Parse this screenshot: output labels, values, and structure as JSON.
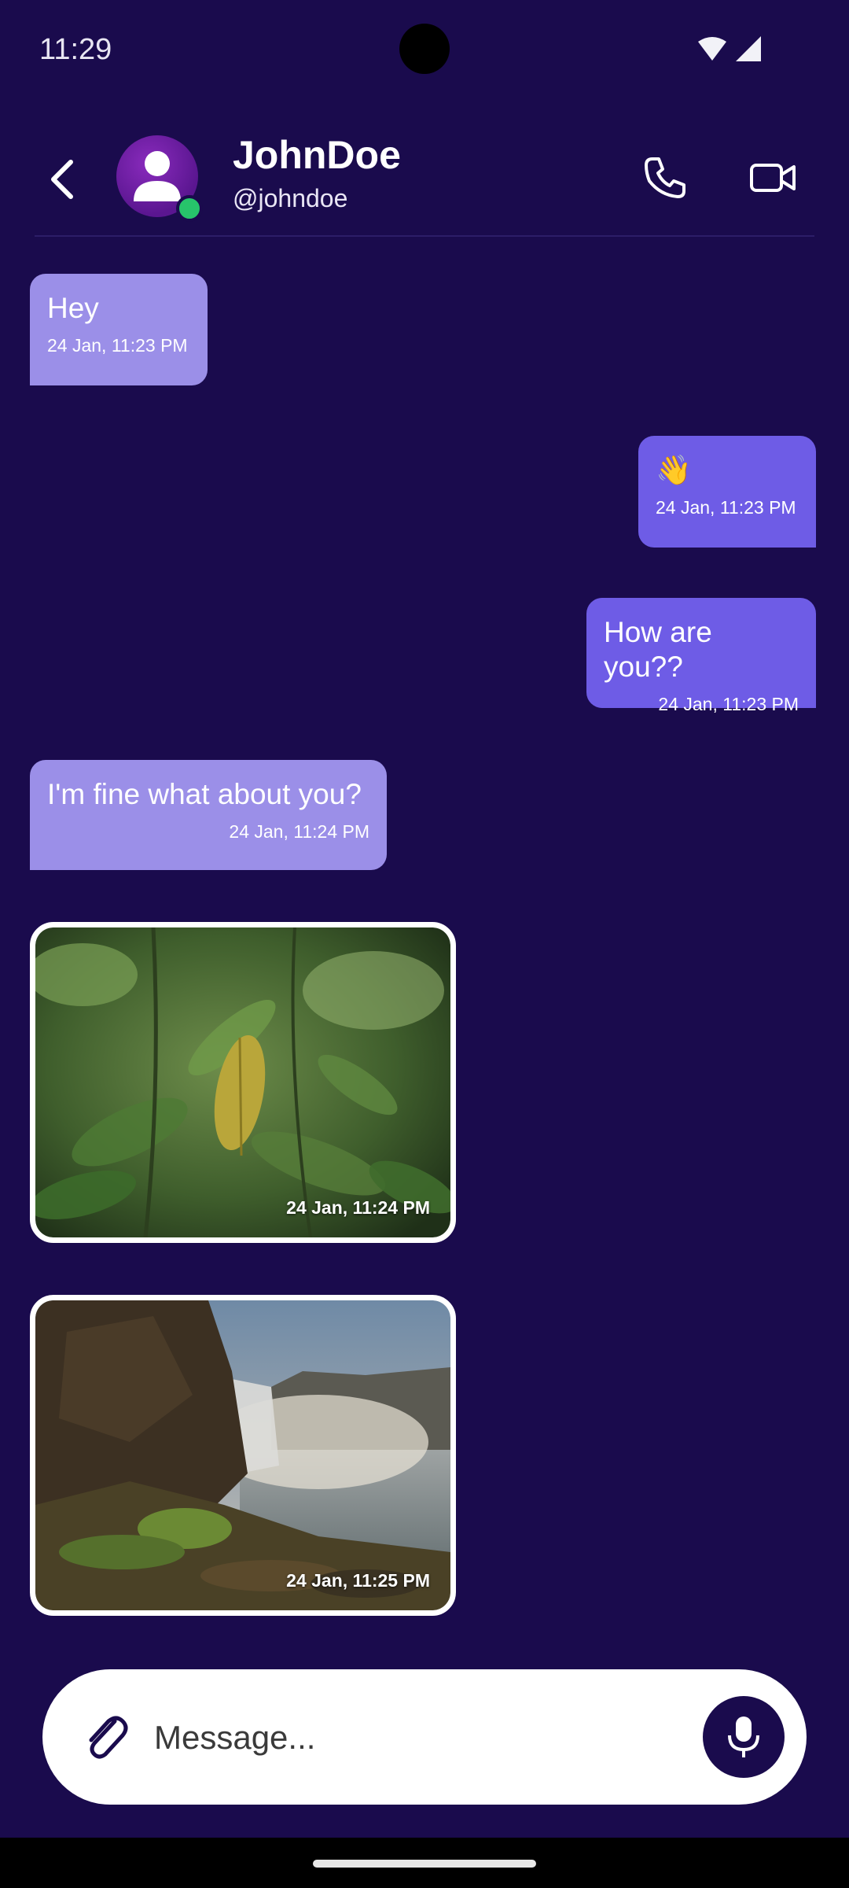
{
  "status_bar": {
    "time": "11:29"
  },
  "header": {
    "name": "JohnDoe",
    "handle": "@johndoe"
  },
  "messages": [
    {
      "text": "Hey",
      "time": "24 Jan, 11:23 PM"
    },
    {
      "text": "👋",
      "time": "24 Jan, 11:23 PM"
    },
    {
      "text": "How are you??",
      "time": "24 Jan, 11:23 PM"
    },
    {
      "text": "I'm fine what about you?",
      "time": "24 Jan, 11:24 PM"
    }
  ],
  "photos": [
    {
      "time": "24 Jan, 11:24 PM"
    },
    {
      "time": "24 Jan, 11:25 PM"
    }
  ],
  "composer": {
    "placeholder": "Message..."
  },
  "colors": {
    "background": "#1a0b4d",
    "incoming_bubble": "#9b8fe8",
    "outgoing_bubble": "#6e5ce6",
    "online": "#27c46b"
  },
  "icons": [
    "back-arrow-icon",
    "user-icon",
    "phone-icon",
    "video-camera-icon",
    "paperclip-icon",
    "microphone-icon",
    "wifi-icon",
    "signal-icon"
  ]
}
